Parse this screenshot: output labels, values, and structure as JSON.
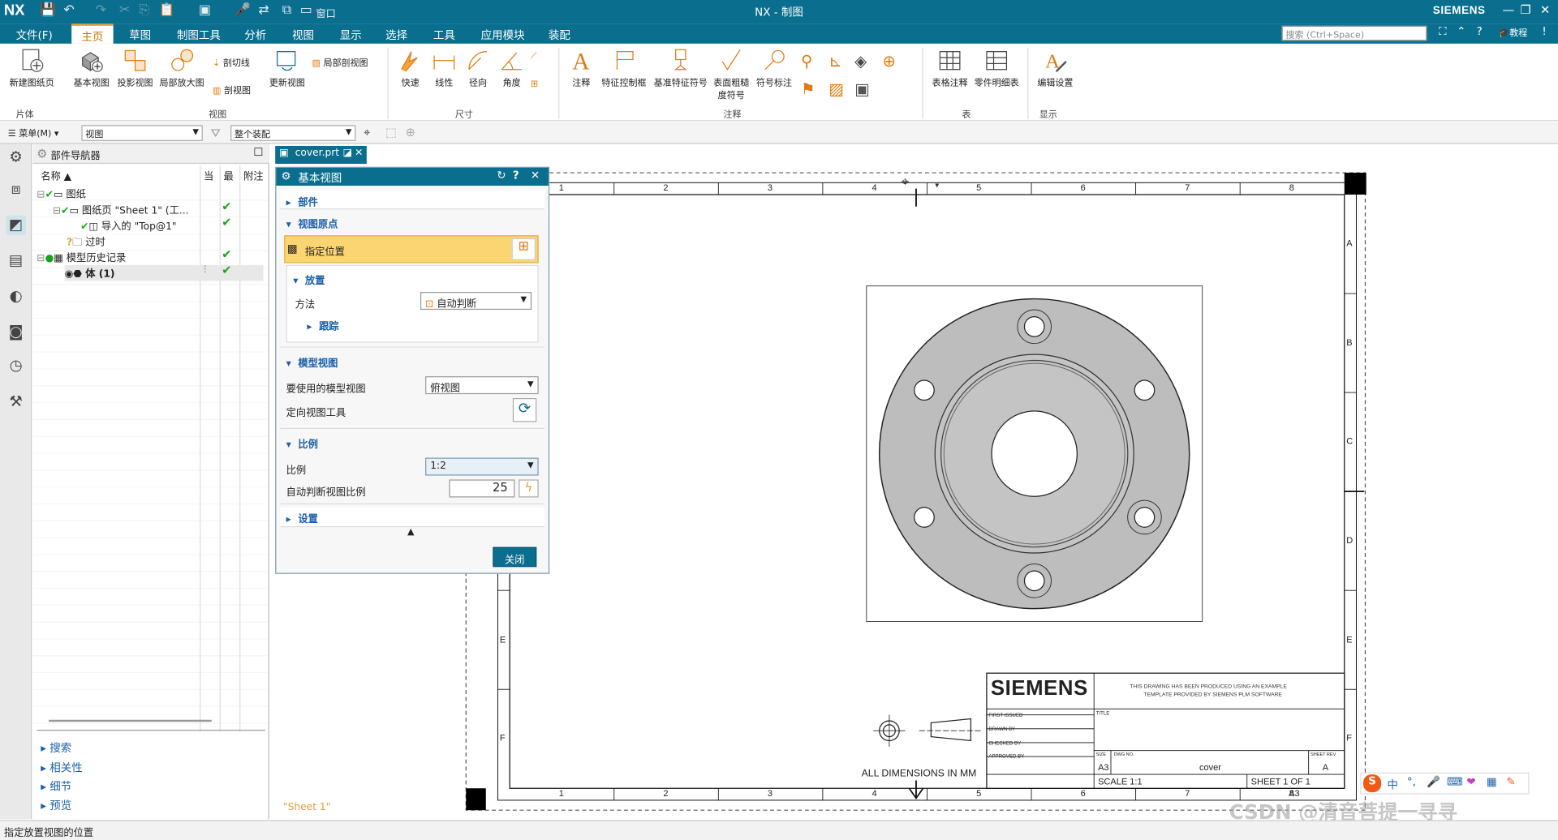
{
  "app": {
    "logo": "NX",
    "title": "NX - 制图",
    "brand": "SIEMENS",
    "window_menu": "窗口"
  },
  "tabs": [
    "文件(F)",
    "主页",
    "草图",
    "制图工具",
    "分析",
    "视图",
    "显示",
    "选择",
    "工具",
    "应用模块",
    "装配"
  ],
  "active_tab": "主页",
  "search": {
    "placeholder": "搜索 (Ctrl+Space)"
  },
  "help": {
    "tutorial": "教程"
  },
  "ribbon": {
    "new_sheet": "新建图纸页",
    "base_view": "基本视图",
    "projected_view": "投影视图",
    "detail_view": "局部放大图",
    "section_line": "剖切线",
    "section_view": "剖视图",
    "update_views": "更新视图",
    "break_out": "局部剖视图",
    "quick": "快速",
    "linear": "线性",
    "radial": "径向",
    "angular": "角度",
    "note": "注释",
    "fcf": "特征控制框",
    "datum": "基准特征符号",
    "surface_finish_1": "表面粗糙",
    "surface_finish_2": "度符号",
    "symbol_label": "符号标注",
    "tabular_note": "表格注释",
    "parts_list": "零件明细表",
    "edit_settings": "编辑设置",
    "groups": {
      "sheet": "片体",
      "view": "视图",
      "dimension": "尺寸",
      "annotation": "注释",
      "table": "表",
      "display": "显示"
    }
  },
  "toolbar": {
    "menu": "菜单(M)",
    "filter": "视图",
    "scope": "整个装配"
  },
  "navigator": {
    "title": "部件导航器",
    "columns": {
      "name": "名称",
      "current": "当",
      "latest": "最",
      "note": "附注"
    },
    "rows": [
      "图纸",
      "图纸页 \"Sheet 1\" (工...",
      "导入的 \"Top@1\"",
      "过时",
      "模型历史记录",
      "体 (1)"
    ],
    "links": [
      "搜索",
      "相关性",
      "细节",
      "预览"
    ]
  },
  "document_tab": "cover.prt",
  "dialog": {
    "title": "基本视图",
    "sections": {
      "part": "部件",
      "view_origin": "视图原点",
      "model_view": "模型视图",
      "scale": "比例",
      "settings": "设置"
    },
    "specify_location": "指定位置",
    "placement": "放置",
    "method_label": "方法",
    "method_value": "自动判断",
    "tracking": "跟踪",
    "model_view_label": "要使用的模型视图",
    "model_view_value": "俯视图",
    "orient_tool": "定向视图工具",
    "scale_label": "比例",
    "scale_value": "1:2",
    "auto_scale_label": "自动判断视图比例",
    "auto_scale_value": "25",
    "close": "关闭"
  },
  "drawing": {
    "columns": [
      "1",
      "2",
      "3",
      "4",
      "5",
      "6",
      "7",
      "8"
    ],
    "rows": [
      "A",
      "B",
      "C",
      "D",
      "E",
      "F"
    ],
    "sheet_label": "\"Sheet 1\"",
    "all_dims": "ALL DIMENSIONS IN MM",
    "title_block": {
      "logo": "SIEMENS",
      "disclaimer_1": "THIS DRAWING HAS BEEN PRODUCED USING AN EXAMPLE",
      "disclaimer_2": "TEMPLATE PROVIDED BY SIEMENS PLM SOFTWARE",
      "first_issued": "FIRST ISSUED",
      "drawn_by": "DRAWN BY",
      "checked_by": "CHECKED BY",
      "approved_by": "APPROVED BY",
      "title_lbl": "TITLE",
      "size_lbl": "SIZE",
      "dwg_no_lbl": "DWG NO.",
      "sheet_rev_lbl": "SHEET REV",
      "size": "A3",
      "dwg_no": "cover",
      "rev": "A",
      "scale": "SCALE 1:1",
      "sheet": "SHEET 1 OF 1",
      "format": "A3"
    }
  },
  "watermark": "CSDN @清音菩提一寻寻",
  "ime": "中",
  "status": "指定放置视图的位置"
}
